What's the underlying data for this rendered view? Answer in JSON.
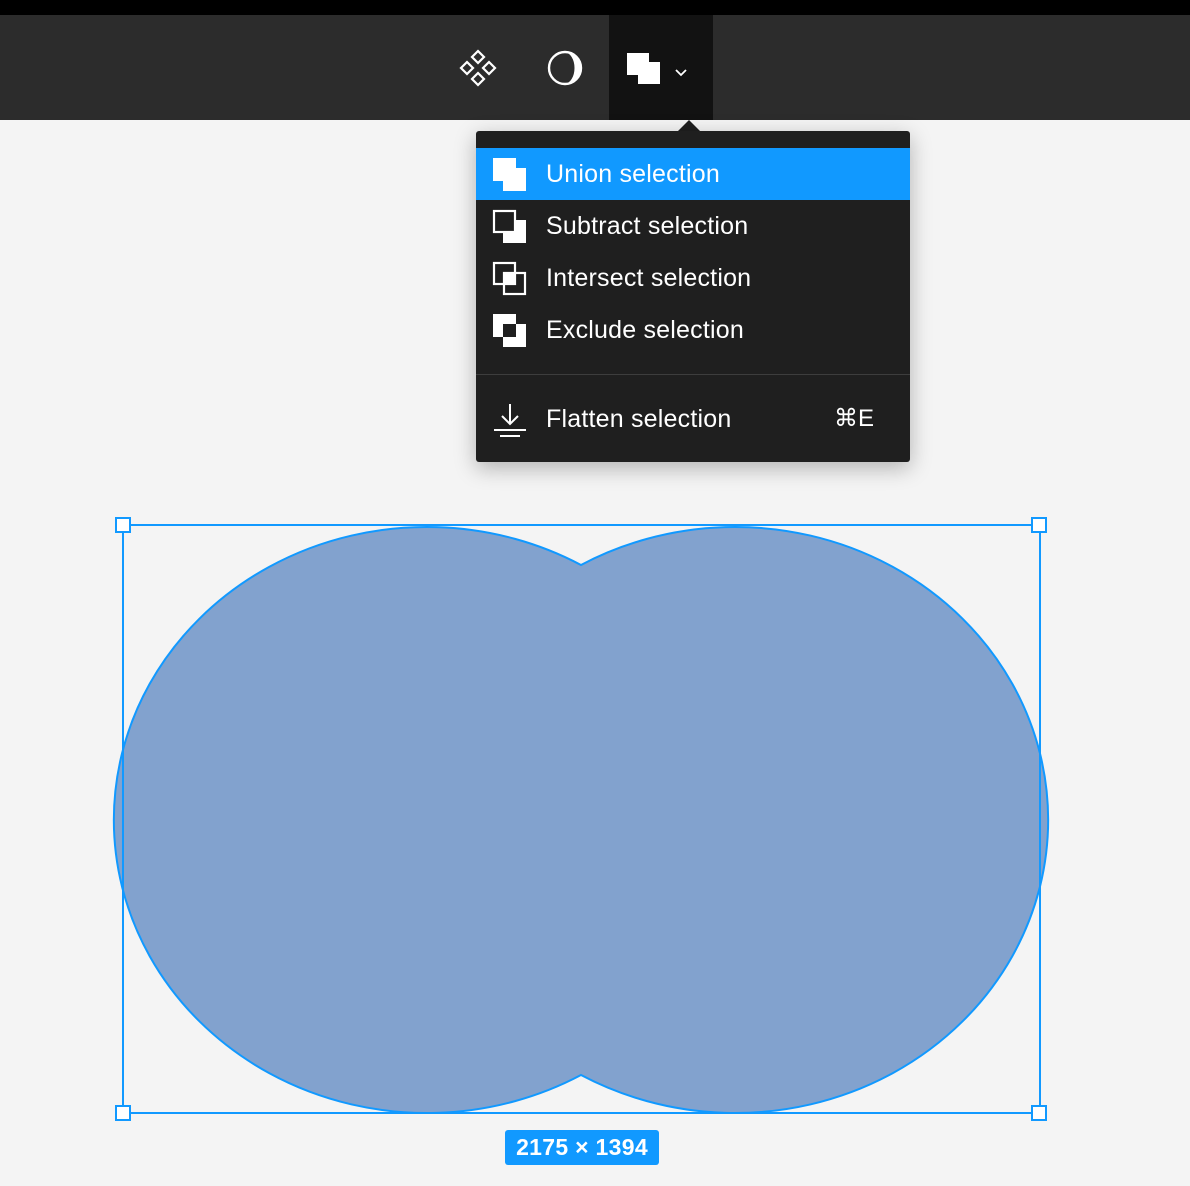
{
  "toolbar": {
    "buttons": [
      {
        "icon": "components-icon"
      },
      {
        "icon": "mask-icon"
      },
      {
        "icon": "boolean-union-icon",
        "dropdown_icon": "chevron-down-icon",
        "active": true
      }
    ]
  },
  "boolean_menu": {
    "items": [
      {
        "label": "Union selection",
        "icon": "union-icon",
        "highlighted": true
      },
      {
        "label": "Subtract selection",
        "icon": "subtract-icon"
      },
      {
        "label": "Intersect selection",
        "icon": "intersect-icon"
      },
      {
        "label": "Exclude selection",
        "icon": "exclude-icon"
      }
    ],
    "flatten": {
      "label": "Flatten selection",
      "icon": "flatten-icon",
      "shortcut": "⌘E"
    }
  },
  "canvas": {
    "shape_fill": "#82a2ce",
    "selection_color": "#1199ff",
    "size_label": "2175 × 1394"
  }
}
